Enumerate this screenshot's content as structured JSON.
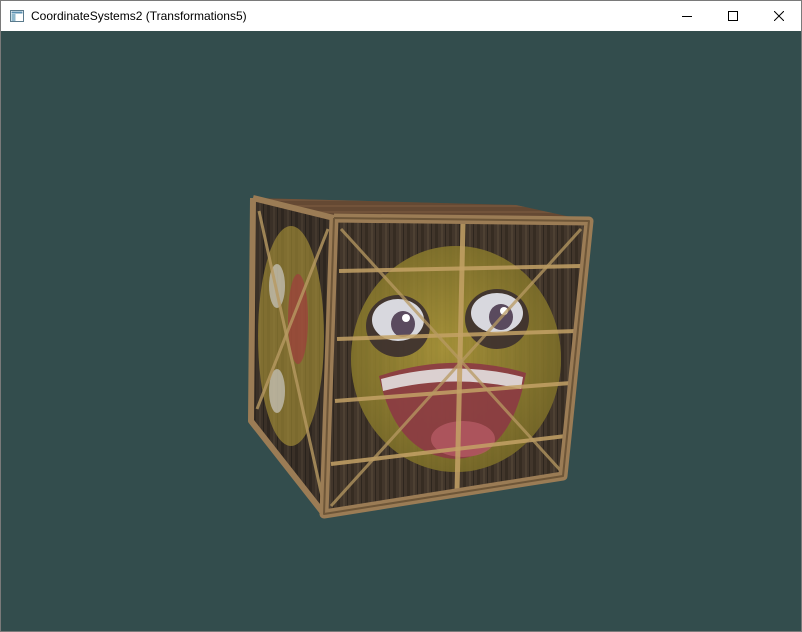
{
  "window": {
    "title": "CoordinateSystems2 (Transformations5)",
    "clear_color": "#334d4d"
  },
  "titlebar_buttons": {
    "minimize_icon": "minimize-icon",
    "maximize_icon": "maximize-icon",
    "close_icon": "close-icon"
  },
  "scene": {
    "object": "textured-cube",
    "textures": [
      "wooden-crate",
      "awesome-face"
    ]
  }
}
